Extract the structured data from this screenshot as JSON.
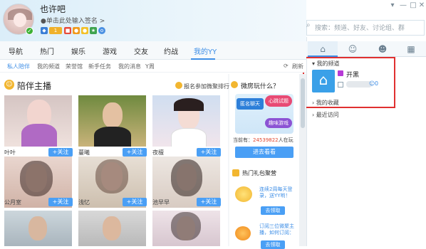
{
  "profile": {
    "username": "也许吧",
    "signature": "●单击此处输入签名 >",
    "level": "1"
  },
  "search": {
    "placeholder": "搜索：频道、好友、讨论组、群"
  },
  "window": {
    "min": "—",
    "max": "□",
    "close": "✕"
  },
  "nav": {
    "items": [
      "导航",
      "热门",
      "娱乐",
      "游戏",
      "交友",
      "约战",
      "我的YY"
    ],
    "active_index": 6
  },
  "subnav": {
    "items": [
      "私人陪伴",
      "我的频道",
      "荣誉馆",
      "新手任务",
      "我的消息",
      "Y周"
    ],
    "refresh": "刷新"
  },
  "anchors": {
    "title": "陪伴主播",
    "promo": "报名参加微聚排行",
    "follow_label": "+关注",
    "cards": [
      {
        "name": "叶叶"
      },
      {
        "name": "蔓曦"
      },
      {
        "name": "夜檀"
      },
      {
        "name": "公月室"
      },
      {
        "name": "浅忆"
      },
      {
        "name": "池早早"
      },
      {
        "name": ""
      },
      {
        "name": ""
      },
      {
        "name": ""
      }
    ]
  },
  "sidebar": {
    "title": "微房玩什么？",
    "tags": [
      "匿名聊天",
      "心跳试题",
      "趣味游戏"
    ],
    "online_prefix": "当前有：",
    "online_count": "24539822",
    "online_suffix": "人在玩",
    "enter_button": "进去看看",
    "gift_title": "热门礼包聚营",
    "gift1_text": "连续2周每天登录，送YY哟！",
    "gift1_button": "去领取",
    "gift2_text": "订阅三位微聚主播，如何订阅：",
    "gift2_button": "去领取"
  },
  "right": {
    "my_channels": "我的频道",
    "channel_name": "开黑",
    "channel_count": "0",
    "favorites": "我的收藏",
    "recent": "最近访问"
  },
  "colors": {
    "accent": "#3e8ee6",
    "highlight": "#e03030",
    "online_count": "#e0462f"
  }
}
